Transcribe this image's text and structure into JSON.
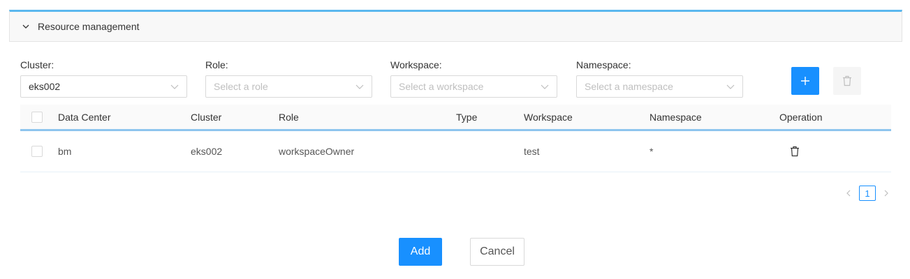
{
  "panel": {
    "title": "Resource management",
    "expanded": true
  },
  "filters": {
    "cluster": {
      "label": "Cluster:",
      "value": "eks002"
    },
    "role": {
      "label": "Role:",
      "placeholder": "Select a role"
    },
    "workspace": {
      "label": "Workspace:",
      "placeholder": "Select a workspace"
    },
    "namespace": {
      "label": "Namespace:",
      "placeholder": "Select a namespace"
    }
  },
  "actions": {
    "add_row_icon": "plus-icon",
    "delete_row_icon": "trash-icon"
  },
  "table": {
    "headers": [
      "Data Center",
      "Cluster",
      "Role",
      "Type",
      "Workspace",
      "Namespace",
      "Operation"
    ],
    "rows": [
      {
        "data_center": "bm",
        "cluster": "eks002",
        "role": "workspaceOwner",
        "type": "",
        "workspace": "test",
        "namespace": "*",
        "operation_icon": "trash-icon"
      }
    ]
  },
  "pagination": {
    "current_page": "1"
  },
  "footer": {
    "add_label": "Add",
    "cancel_label": "Cancel"
  },
  "colors": {
    "accent": "#1890ff",
    "panel_border": "#5bb8ee"
  }
}
